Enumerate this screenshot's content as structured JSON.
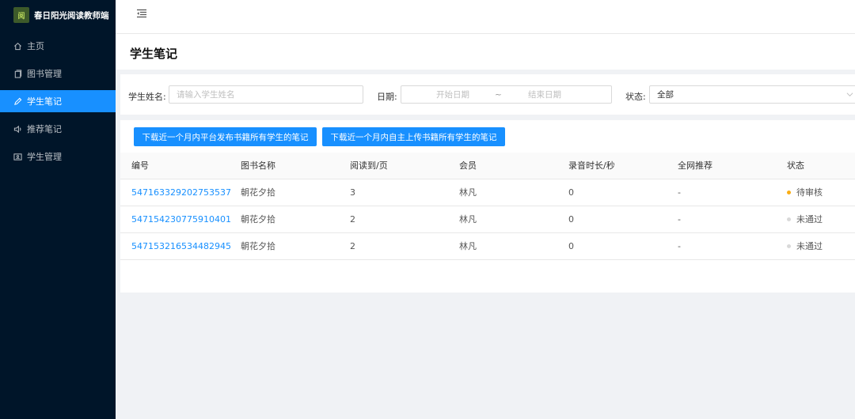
{
  "app": {
    "logo_glyph": "阅",
    "title": "春日阳光阅读教师端"
  },
  "sidebar": {
    "items": [
      {
        "label": "主页",
        "icon": "home-icon"
      },
      {
        "label": "图书管理",
        "icon": "book-icon"
      },
      {
        "label": "学生笔记",
        "icon": "note-icon",
        "active": true
      },
      {
        "label": "推荐笔记",
        "icon": "sound-icon"
      },
      {
        "label": "学生管理",
        "icon": "user-card-icon"
      }
    ]
  },
  "page": {
    "title": "学生笔记"
  },
  "filters": {
    "name_label": "学生姓名:",
    "name_placeholder": "请输入学生姓名",
    "date_label": "日期:",
    "date_start_placeholder": "开始日期",
    "date_separator": "~",
    "date_end_placeholder": "结束日期",
    "status_label": "状态:",
    "status_value": "全部"
  },
  "actions": {
    "download_platform": "下载近一个月内平台发布书籍所有学生的笔记",
    "download_self": "下载近一个月内自主上传书籍所有学生的笔记"
  },
  "table": {
    "columns": [
      "编号",
      "图书名称",
      "阅读到/页",
      "会员",
      "录音时长/秒",
      "全网推荐",
      "状态"
    ],
    "rows": [
      {
        "id": "547163329202753537",
        "book": "朝花夕拾",
        "page": "3",
        "member": "林凡",
        "duration": "0",
        "recommend": "-",
        "status": "待审核",
        "status_color": "#faad14"
      },
      {
        "id": "547154230775910401",
        "book": "朝花夕拾",
        "page": "2",
        "member": "林凡",
        "duration": "0",
        "recommend": "-",
        "status": "未通过",
        "status_color": "#d9d9d9"
      },
      {
        "id": "547153216534482945",
        "book": "朝花夕拾",
        "page": "2",
        "member": "林凡",
        "duration": "0",
        "recommend": "-",
        "status": "未通过",
        "status_color": "#d9d9d9"
      }
    ]
  },
  "colors": {
    "sidebar_bg": "#001529",
    "primary": "#1890ff",
    "pending": "#faad14",
    "rejected": "#d9d9d9"
  }
}
